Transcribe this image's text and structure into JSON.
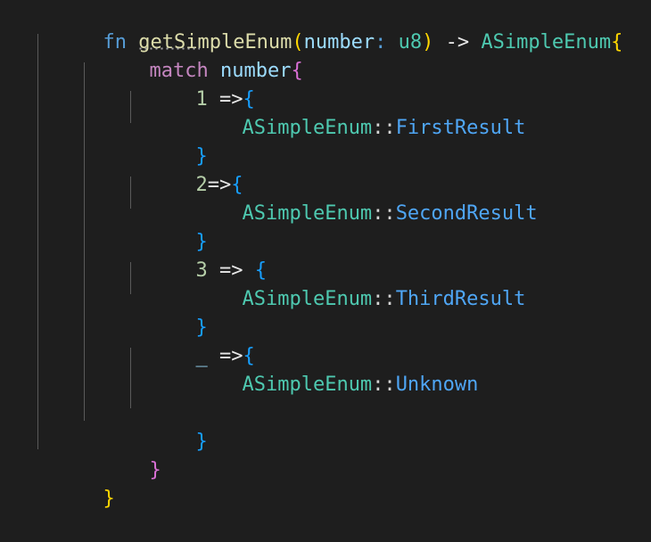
{
  "editor": {
    "language": "rust",
    "background_color": "#1e1e1e",
    "font_size_px": 22,
    "line_height_px": 32,
    "indent_guide_color": "#5a5a5a",
    "colors": {
      "keyword": "#569cd6",
      "control_keyword": "#c586c0",
      "function_name": "#dcdcaa",
      "parameter": "#9cdcfe",
      "type": "#4ec9b0",
      "number": "#b5cea8",
      "operator": "#e8e8e8",
      "punctuation": "#d4d4d4",
      "enum_variant": "#4fa6f5",
      "bracket_level_1": "#ffd700",
      "bracket_level_2": "#da70d6",
      "bracket_level_3": "#179fff"
    }
  },
  "code": {
    "lines": [
      {
        "n": 1,
        "indent": 0,
        "text": "fn getSimpleEnum(number: u8) -> ASimpleEnum{",
        "tokens": {
          "fn": "fn",
          "space": " ",
          "name": "getSimpleEnum",
          "paren_open": "(",
          "param": "number",
          "colon": ":",
          "param_type": "u8",
          "paren_close": ")",
          "arrow": "->",
          "return_type": "ASimpleEnum",
          "brace_open": "{"
        }
      },
      {
        "n": 2,
        "indent": 1,
        "text": "match number{",
        "tokens": {
          "match": "match",
          "subject": "number",
          "brace_open": "{"
        }
      },
      {
        "n": 3,
        "indent": 2,
        "text": "1 =>{",
        "tokens": {
          "pattern": "1",
          "arrow": "=>",
          "brace_open": "{"
        }
      },
      {
        "n": 4,
        "indent": 3,
        "text": "ASimpleEnum::FirstResult",
        "tokens": {
          "enum_type": "ASimpleEnum",
          "path_sep": "::",
          "variant": "FirstResult"
        }
      },
      {
        "n": 5,
        "indent": 2,
        "text": "}",
        "tokens": {
          "brace_close": "}"
        }
      },
      {
        "n": 6,
        "indent": 2,
        "text": "2=>{",
        "tokens": {
          "pattern": "2",
          "arrow": "=>",
          "brace_open": "{"
        }
      },
      {
        "n": 7,
        "indent": 3,
        "text": "ASimpleEnum::SecondResult",
        "tokens": {
          "enum_type": "ASimpleEnum",
          "path_sep": "::",
          "variant": "SecondResult"
        }
      },
      {
        "n": 8,
        "indent": 2,
        "text": "}",
        "tokens": {
          "brace_close": "}"
        }
      },
      {
        "n": 9,
        "indent": 2,
        "text": "3 => {",
        "tokens": {
          "pattern": "3",
          "arrow": "=>",
          "brace_open": "{"
        }
      },
      {
        "n": 10,
        "indent": 3,
        "text": "ASimpleEnum::ThirdResult",
        "tokens": {
          "enum_type": "ASimpleEnum",
          "path_sep": "::",
          "variant": "ThirdResult"
        }
      },
      {
        "n": 11,
        "indent": 2,
        "text": "}",
        "tokens": {
          "brace_close": "}"
        }
      },
      {
        "n": 12,
        "indent": 2,
        "text": "_ =>{",
        "tokens": {
          "pattern": "_",
          "arrow": "=>",
          "brace_open": "{"
        }
      },
      {
        "n": 13,
        "indent": 3,
        "text": "ASimpleEnum::Unknown",
        "tokens": {
          "enum_type": "ASimpleEnum",
          "path_sep": "::",
          "variant": "Unknown"
        }
      },
      {
        "n": 14,
        "indent": 0,
        "text": ""
      },
      {
        "n": 15,
        "indent": 2,
        "text": "}",
        "tokens": {
          "brace_close": "}"
        }
      },
      {
        "n": 16,
        "indent": 1,
        "text": "}",
        "tokens": {
          "brace_close": "}"
        }
      },
      {
        "n": 17,
        "indent": 0,
        "text": "}",
        "tokens": {
          "brace_close": "}"
        }
      }
    ]
  },
  "diagnostics": {
    "unused_function_hint_target": "getSimpleEnum"
  }
}
